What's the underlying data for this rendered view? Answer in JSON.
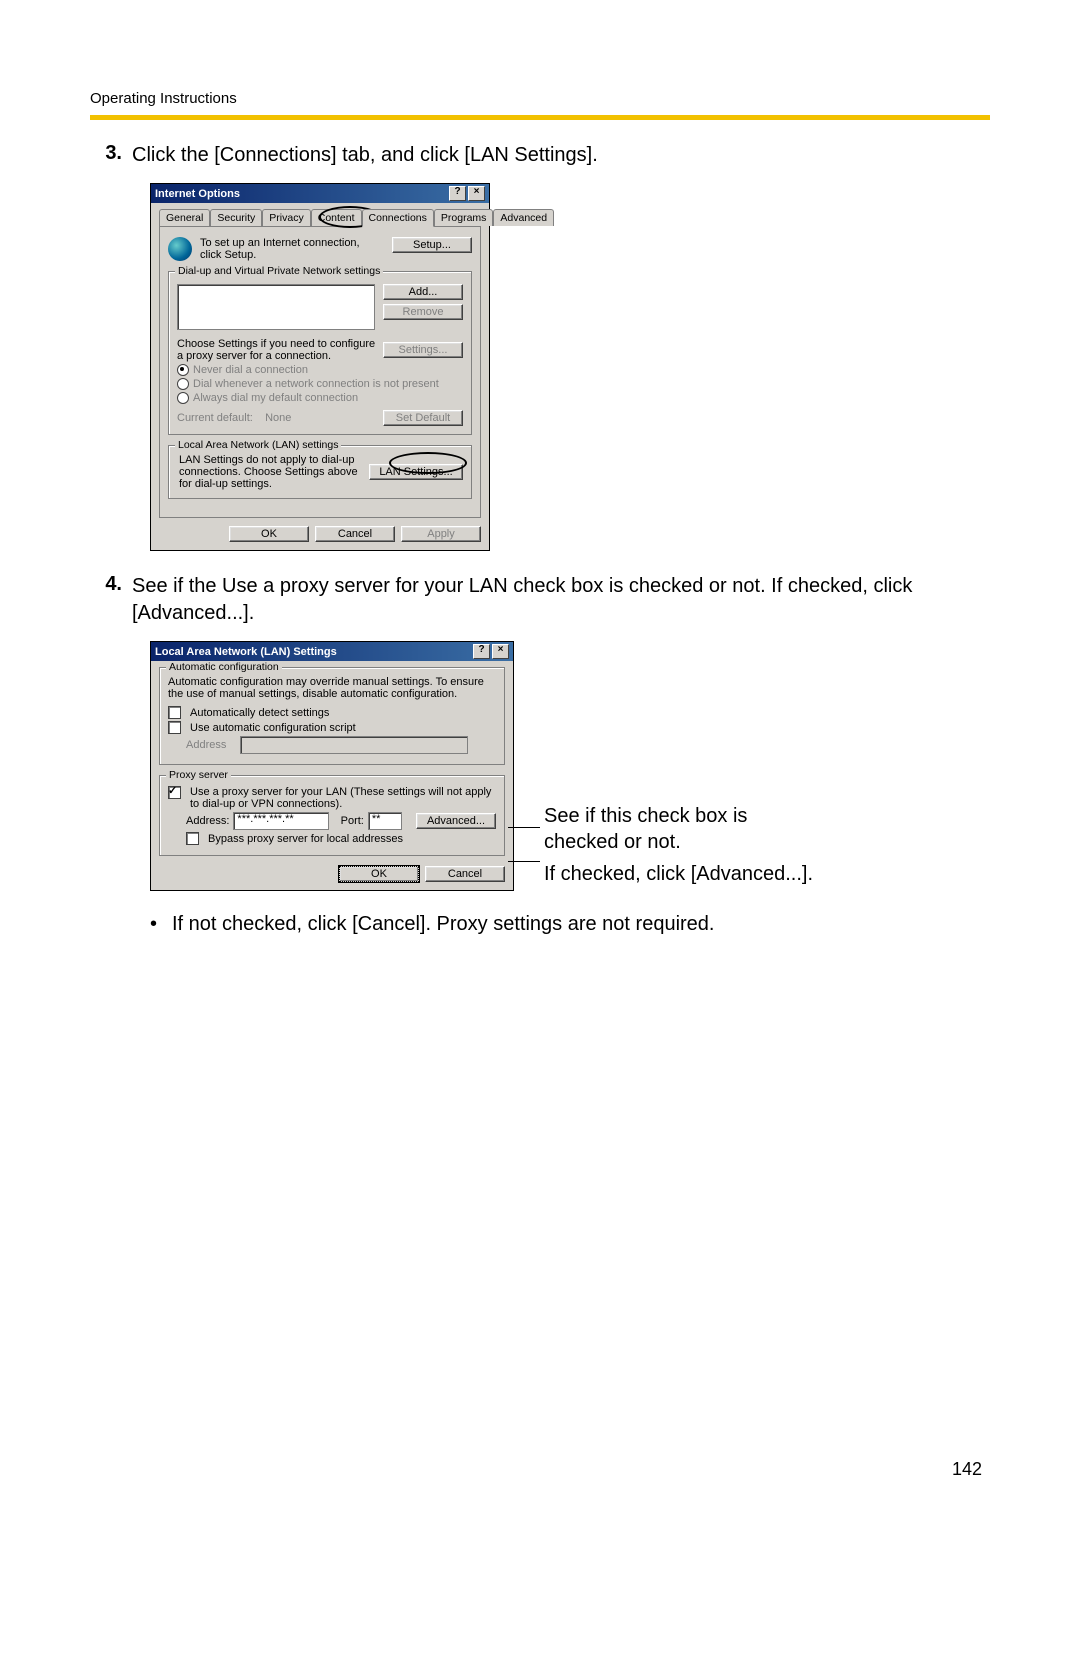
{
  "header": {
    "section_title": "Operating Instructions"
  },
  "steps": {
    "s3": {
      "num": "3.",
      "text": "Click the [Connections] tab, and click [LAN Settings]."
    },
    "s4": {
      "num": "4.",
      "text": "See if the Use a proxy server for your LAN check box is checked or not. If checked, click [Advanced...]."
    },
    "bullet": "If not checked, click [Cancel]. Proxy settings are not required."
  },
  "dialog1": {
    "title": "Internet Options",
    "help_btn": "?",
    "close_btn": "×",
    "tabs": {
      "general": "General",
      "security": "Security",
      "privacy": "Privacy",
      "content": "Content",
      "connections": "Connections",
      "programs": "Programs",
      "advanced": "Advanced"
    },
    "setup_text": "To set up an Internet connection, click Setup.",
    "btn_setup": "Setup...",
    "fs_dialup_legend": "Dial-up and Virtual Private Network settings",
    "btn_add": "Add...",
    "btn_remove": "Remove",
    "choose_settings": "Choose Settings if you need to configure a proxy server for a connection.",
    "btn_settings": "Settings...",
    "radio_never": "Never dial a connection",
    "radio_whenever": "Dial whenever a network connection is not present",
    "radio_always": "Always dial my default connection",
    "current_default_label": "Current default:",
    "current_default_value": "None",
    "btn_set_default": "Set Default",
    "fs_lan_legend": "Local Area Network (LAN) settings",
    "lan_text": "LAN Settings do not apply to dial-up connections. Choose Settings above for dial-up settings.",
    "btn_lan": "LAN Settings...",
    "btn_ok": "OK",
    "btn_cancel": "Cancel",
    "btn_apply": "Apply"
  },
  "dialog2": {
    "title": "Local Area Network (LAN) Settings",
    "help_btn": "?",
    "close_btn": "×",
    "fs_auto_legend": "Automatic configuration",
    "auto_desc": "Automatic configuration may override manual settings. To ensure the use of manual settings, disable automatic configuration.",
    "chk_auto_detect": "Automatically detect settings",
    "chk_use_script": "Use automatic configuration script",
    "address_label": "Address",
    "fs_proxy_legend": "Proxy server",
    "chk_use_proxy": "Use a proxy server for your LAN (These settings will not apply to dial-up or VPN connections).",
    "proxy_address_label": "Address:",
    "proxy_address_value": "***.***.***.**",
    "proxy_port_label": "Port:",
    "proxy_port_value": "**",
    "btn_advanced": "Advanced...",
    "chk_bypass": "Bypass proxy server for local addresses",
    "btn_ok": "OK",
    "btn_cancel": "Cancel"
  },
  "callouts": {
    "c1": "See if this check box is checked or not.",
    "c2": "If checked, click [Advanced...]."
  },
  "page_number": "142"
}
